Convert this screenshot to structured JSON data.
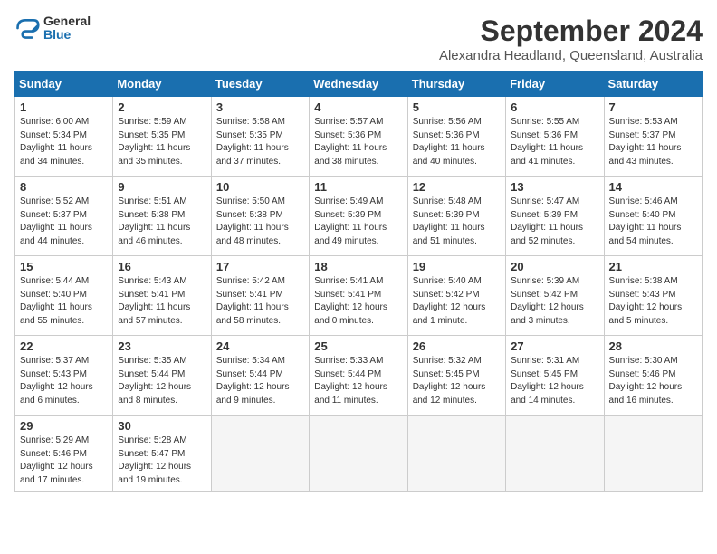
{
  "logo": {
    "line1": "General",
    "line2": "Blue"
  },
  "title": "September 2024",
  "location": "Alexandra Headland, Queensland, Australia",
  "headers": [
    "Sunday",
    "Monday",
    "Tuesday",
    "Wednesday",
    "Thursday",
    "Friday",
    "Saturday"
  ],
  "weeks": [
    [
      {
        "day": "1",
        "info": "Sunrise: 6:00 AM\nSunset: 5:34 PM\nDaylight: 11 hours\nand 34 minutes."
      },
      {
        "day": "2",
        "info": "Sunrise: 5:59 AM\nSunset: 5:35 PM\nDaylight: 11 hours\nand 35 minutes."
      },
      {
        "day": "3",
        "info": "Sunrise: 5:58 AM\nSunset: 5:35 PM\nDaylight: 11 hours\nand 37 minutes."
      },
      {
        "day": "4",
        "info": "Sunrise: 5:57 AM\nSunset: 5:36 PM\nDaylight: 11 hours\nand 38 minutes."
      },
      {
        "day": "5",
        "info": "Sunrise: 5:56 AM\nSunset: 5:36 PM\nDaylight: 11 hours\nand 40 minutes."
      },
      {
        "day": "6",
        "info": "Sunrise: 5:55 AM\nSunset: 5:36 PM\nDaylight: 11 hours\nand 41 minutes."
      },
      {
        "day": "7",
        "info": "Sunrise: 5:53 AM\nSunset: 5:37 PM\nDaylight: 11 hours\nand 43 minutes."
      }
    ],
    [
      {
        "day": "8",
        "info": "Sunrise: 5:52 AM\nSunset: 5:37 PM\nDaylight: 11 hours\nand 44 minutes."
      },
      {
        "day": "9",
        "info": "Sunrise: 5:51 AM\nSunset: 5:38 PM\nDaylight: 11 hours\nand 46 minutes."
      },
      {
        "day": "10",
        "info": "Sunrise: 5:50 AM\nSunset: 5:38 PM\nDaylight: 11 hours\nand 48 minutes."
      },
      {
        "day": "11",
        "info": "Sunrise: 5:49 AM\nSunset: 5:39 PM\nDaylight: 11 hours\nand 49 minutes."
      },
      {
        "day": "12",
        "info": "Sunrise: 5:48 AM\nSunset: 5:39 PM\nDaylight: 11 hours\nand 51 minutes."
      },
      {
        "day": "13",
        "info": "Sunrise: 5:47 AM\nSunset: 5:39 PM\nDaylight: 11 hours\nand 52 minutes."
      },
      {
        "day": "14",
        "info": "Sunrise: 5:46 AM\nSunset: 5:40 PM\nDaylight: 11 hours\nand 54 minutes."
      }
    ],
    [
      {
        "day": "15",
        "info": "Sunrise: 5:44 AM\nSunset: 5:40 PM\nDaylight: 11 hours\nand 55 minutes."
      },
      {
        "day": "16",
        "info": "Sunrise: 5:43 AM\nSunset: 5:41 PM\nDaylight: 11 hours\nand 57 minutes."
      },
      {
        "day": "17",
        "info": "Sunrise: 5:42 AM\nSunset: 5:41 PM\nDaylight: 11 hours\nand 58 minutes."
      },
      {
        "day": "18",
        "info": "Sunrise: 5:41 AM\nSunset: 5:41 PM\nDaylight: 12 hours\nand 0 minutes."
      },
      {
        "day": "19",
        "info": "Sunrise: 5:40 AM\nSunset: 5:42 PM\nDaylight: 12 hours\nand 1 minute."
      },
      {
        "day": "20",
        "info": "Sunrise: 5:39 AM\nSunset: 5:42 PM\nDaylight: 12 hours\nand 3 minutes."
      },
      {
        "day": "21",
        "info": "Sunrise: 5:38 AM\nSunset: 5:43 PM\nDaylight: 12 hours\nand 5 minutes."
      }
    ],
    [
      {
        "day": "22",
        "info": "Sunrise: 5:37 AM\nSunset: 5:43 PM\nDaylight: 12 hours\nand 6 minutes."
      },
      {
        "day": "23",
        "info": "Sunrise: 5:35 AM\nSunset: 5:44 PM\nDaylight: 12 hours\nand 8 minutes."
      },
      {
        "day": "24",
        "info": "Sunrise: 5:34 AM\nSunset: 5:44 PM\nDaylight: 12 hours\nand 9 minutes."
      },
      {
        "day": "25",
        "info": "Sunrise: 5:33 AM\nSunset: 5:44 PM\nDaylight: 12 hours\nand 11 minutes."
      },
      {
        "day": "26",
        "info": "Sunrise: 5:32 AM\nSunset: 5:45 PM\nDaylight: 12 hours\nand 12 minutes."
      },
      {
        "day": "27",
        "info": "Sunrise: 5:31 AM\nSunset: 5:45 PM\nDaylight: 12 hours\nand 14 minutes."
      },
      {
        "day": "28",
        "info": "Sunrise: 5:30 AM\nSunset: 5:46 PM\nDaylight: 12 hours\nand 16 minutes."
      }
    ],
    [
      {
        "day": "29",
        "info": "Sunrise: 5:29 AM\nSunset: 5:46 PM\nDaylight: 12 hours\nand 17 minutes."
      },
      {
        "day": "30",
        "info": "Sunrise: 5:28 AM\nSunset: 5:47 PM\nDaylight: 12 hours\nand 19 minutes."
      },
      {
        "day": "",
        "info": "",
        "empty": true
      },
      {
        "day": "",
        "info": "",
        "empty": true
      },
      {
        "day": "",
        "info": "",
        "empty": true
      },
      {
        "day": "",
        "info": "",
        "empty": true
      },
      {
        "day": "",
        "info": "",
        "empty": true
      }
    ]
  ]
}
